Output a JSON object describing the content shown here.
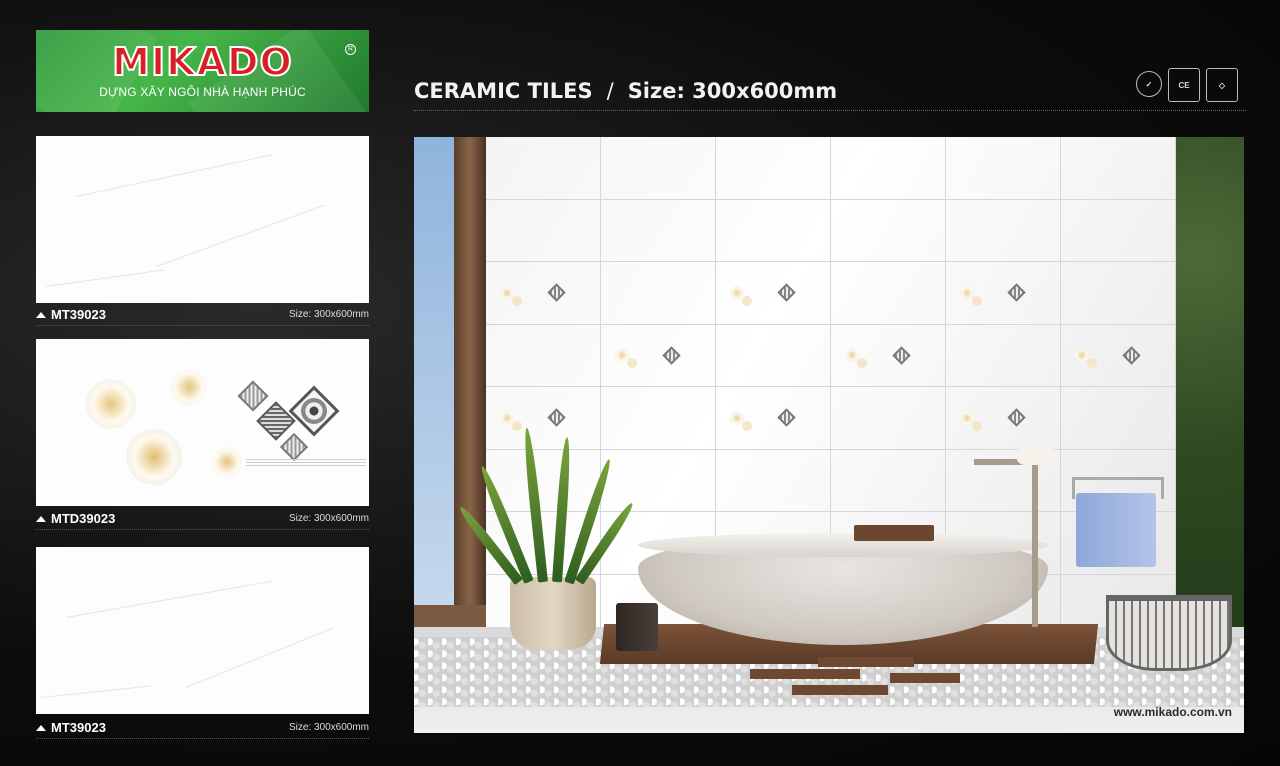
{
  "brand": {
    "name": "MIKADO",
    "registered": "R",
    "slogan": "DỰNG XÂY NGÔI NHÀ HẠNH PHÚC",
    "colors": {
      "logo_bg": "#47b649",
      "logo_text": "#d91f26"
    }
  },
  "header": {
    "product": "CERAMIC TILES",
    "separator": "/",
    "size": "Size: 300x600mm"
  },
  "certifications": [
    {
      "icon": "quacert-icon"
    },
    {
      "icon": "ce-mark-icon"
    },
    {
      "icon": "quality-mark-icon"
    }
  ],
  "tiles": [
    {
      "code": "MT39023",
      "size": "Size: 300x600mm",
      "style": "plain-white-marble"
    },
    {
      "code": "MTD39023",
      "size": "Size: 300x600mm",
      "style": "rose-and-diamond-decor"
    },
    {
      "code": "MT39023",
      "size": "Size: 300x600mm",
      "style": "plain-white-marble"
    }
  ],
  "scene": {
    "website": "www.mikado.com.vn",
    "description_icons": [
      "bathtub-icon",
      "plant-icon",
      "towel-icon",
      "basket-icon"
    ]
  }
}
